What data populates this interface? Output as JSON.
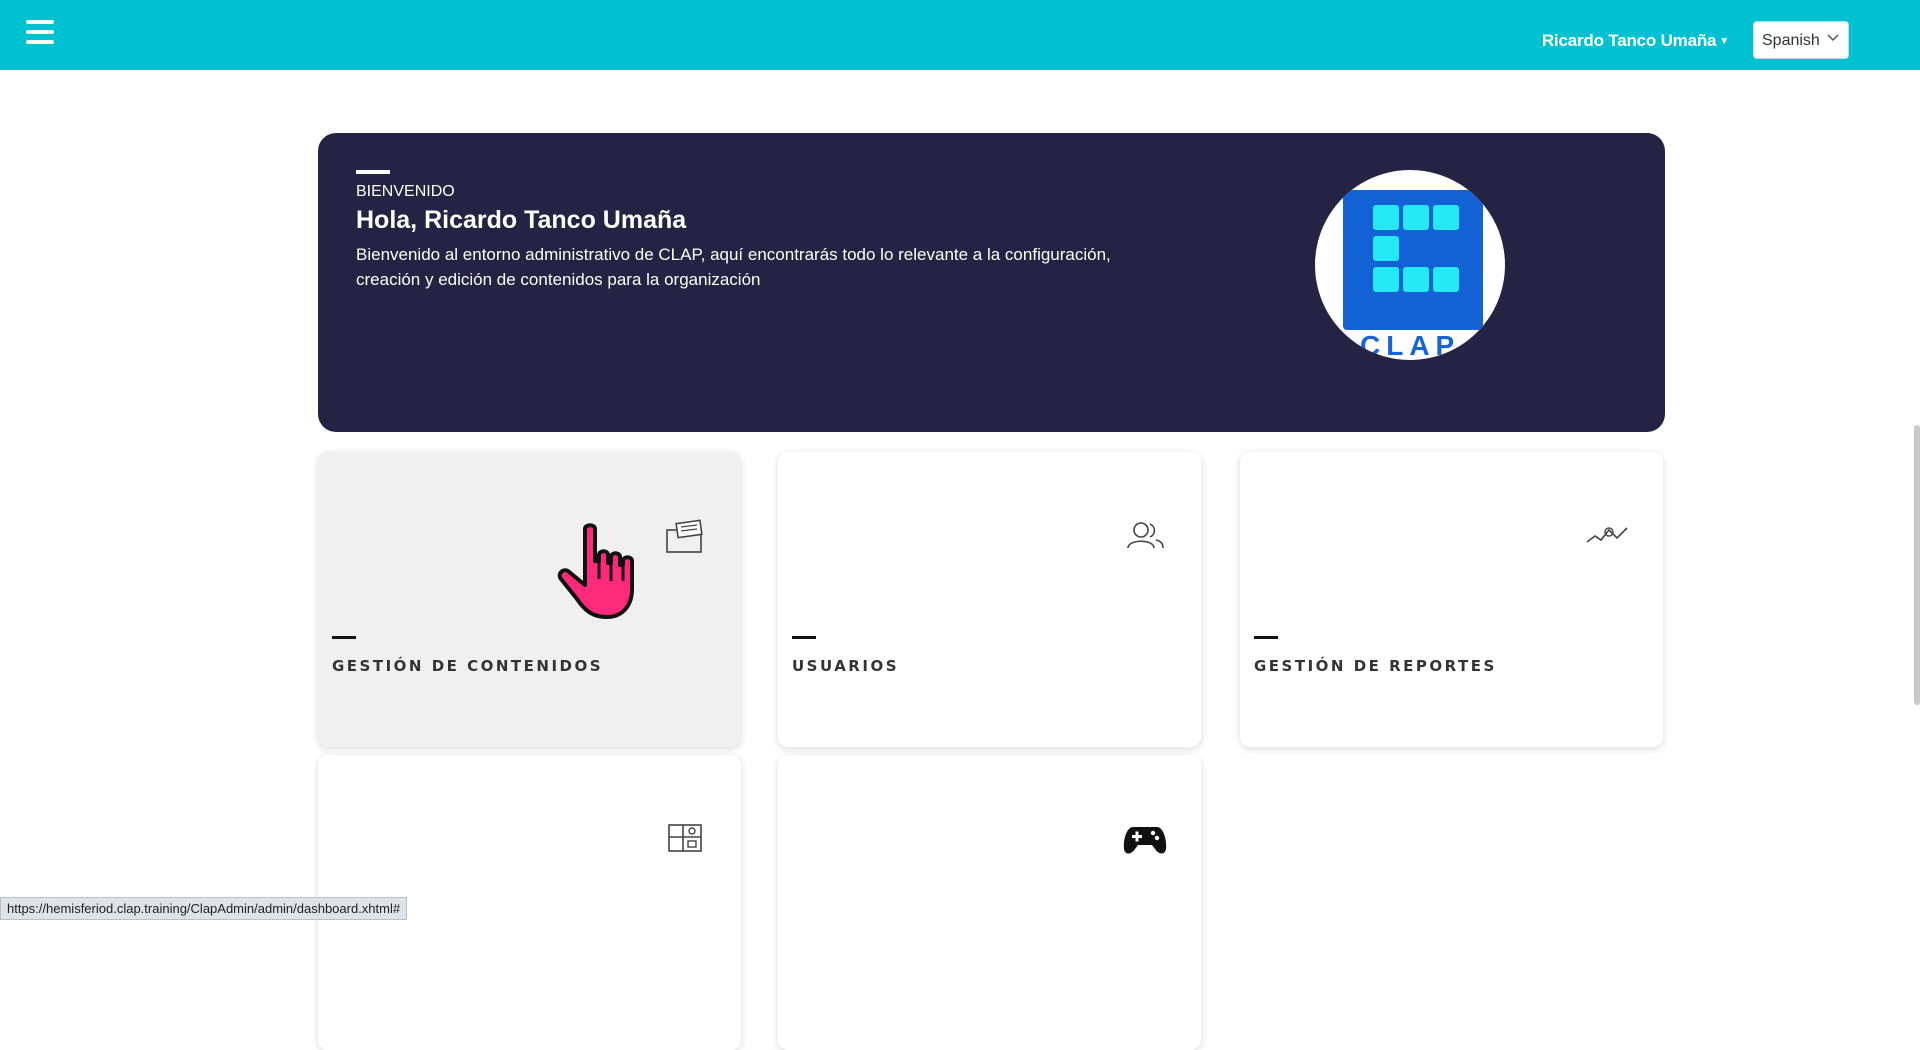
{
  "topbar": {
    "user_name": "Ricardo Tanco Umaña",
    "language": "Spanish",
    "accent_color": "#00c1d2"
  },
  "banner": {
    "eyebrow": "BIENVENIDO",
    "title": "Hola, Ricardo Tanco Umaña",
    "description": "Bienvenido al entorno administrativo de CLAP, aquí encontrarás todo lo relevante a la configuración, creación y edición de contenidos para la organización",
    "logo_text": "CLAP",
    "background_color": "#252343"
  },
  "cards": [
    {
      "label": "GESTIÓN DE CONTENIDOS",
      "icon": "folder-icon",
      "hovered": true
    },
    {
      "label": "USUARIOS",
      "icon": "users-icon",
      "hovered": false
    },
    {
      "label": "GESTIÓN DE REPORTES",
      "icon": "trend-chart-icon",
      "hovered": false
    },
    {
      "label": "",
      "icon": "layout-grid-icon",
      "hovered": false
    },
    {
      "label": "",
      "icon": "gamepad-icon",
      "hovered": false
    }
  ],
  "status_bar": {
    "url": "https://hemisferiod.clap.training/ClapAdmin/admin/dashboard.xhtml#"
  }
}
